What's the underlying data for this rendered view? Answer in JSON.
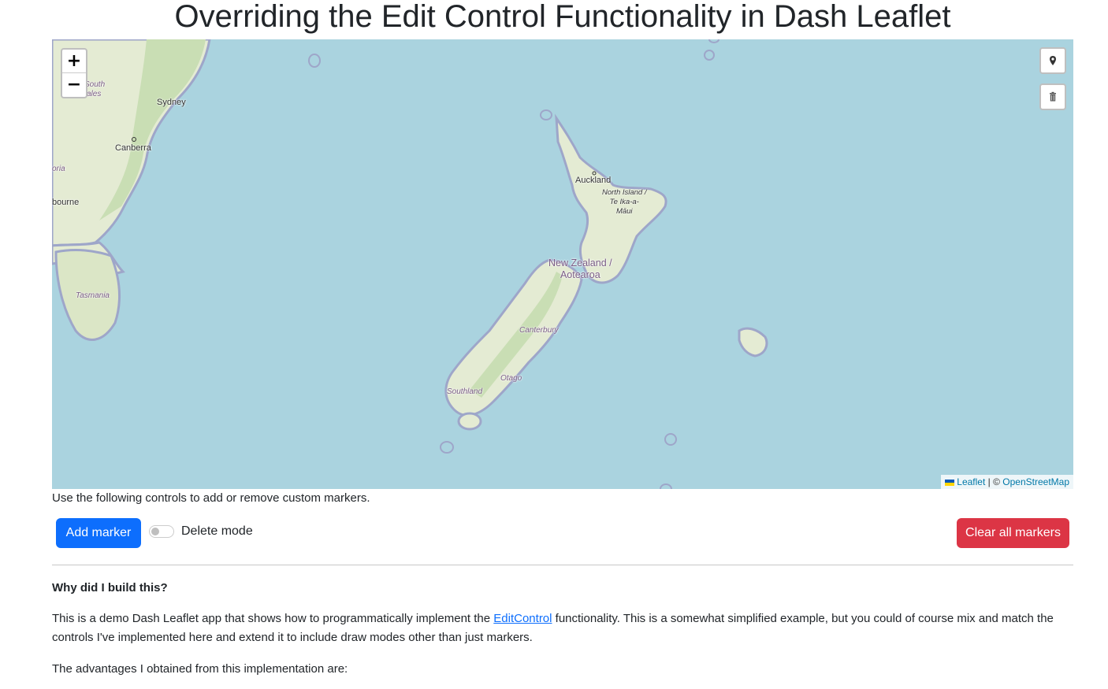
{
  "page": {
    "title": "Overriding the Edit Control Functionality in Dash Leaflet"
  },
  "map": {
    "zoom_in_label": "+",
    "zoom_out_label": "−",
    "draw_marker_icon": "map-marker-icon",
    "delete_icon": "trash-icon",
    "labels": {
      "sydney": "Sydney",
      "canberra": "Canberra",
      "melbourne": "bourne",
      "victoria": "oria",
      "nsw_1": "South",
      "nsw_2": "ales",
      "tasmania": "Tasmania",
      "auckland": "Auckland",
      "north_island_1": "North Island /",
      "north_island_2": "Te Ika-a-",
      "north_island_3": "Māui",
      "nz_1": "New Zealand /",
      "nz_2": "Aotearoa",
      "canterbury": "Canterbury",
      "otago": "Otago",
      "southland": "Southland"
    },
    "attribution": {
      "leaflet": "Leaflet",
      "separator": " | © ",
      "osm": "OpenStreetMap"
    },
    "colors": {
      "water": "#aad3df",
      "land": "#e6eed5",
      "forest": "#c8dfb4",
      "coast": "#9ea6c9"
    }
  },
  "controls": {
    "intro_text": "Use the following controls to add or remove custom markers.",
    "add_marker_label": "Add marker",
    "delete_mode_label": "Delete mode",
    "delete_mode_on": false,
    "clear_all_label": "Clear all markers",
    "colors": {
      "primary": "#0d6efd",
      "danger": "#dc3545"
    }
  },
  "content": {
    "heading": "Why did I build this?",
    "para1_before": "This is a demo Dash Leaflet app that shows how to programmatically implement the ",
    "para1_link": "EditControl",
    "para1_after": " functionality. This is a somewhat simplified example, but you could of course mix and match the controls I've implemented here and extend it to include draw modes other than just markers.",
    "para2": "The advantages I obtained from this implementation are:"
  }
}
